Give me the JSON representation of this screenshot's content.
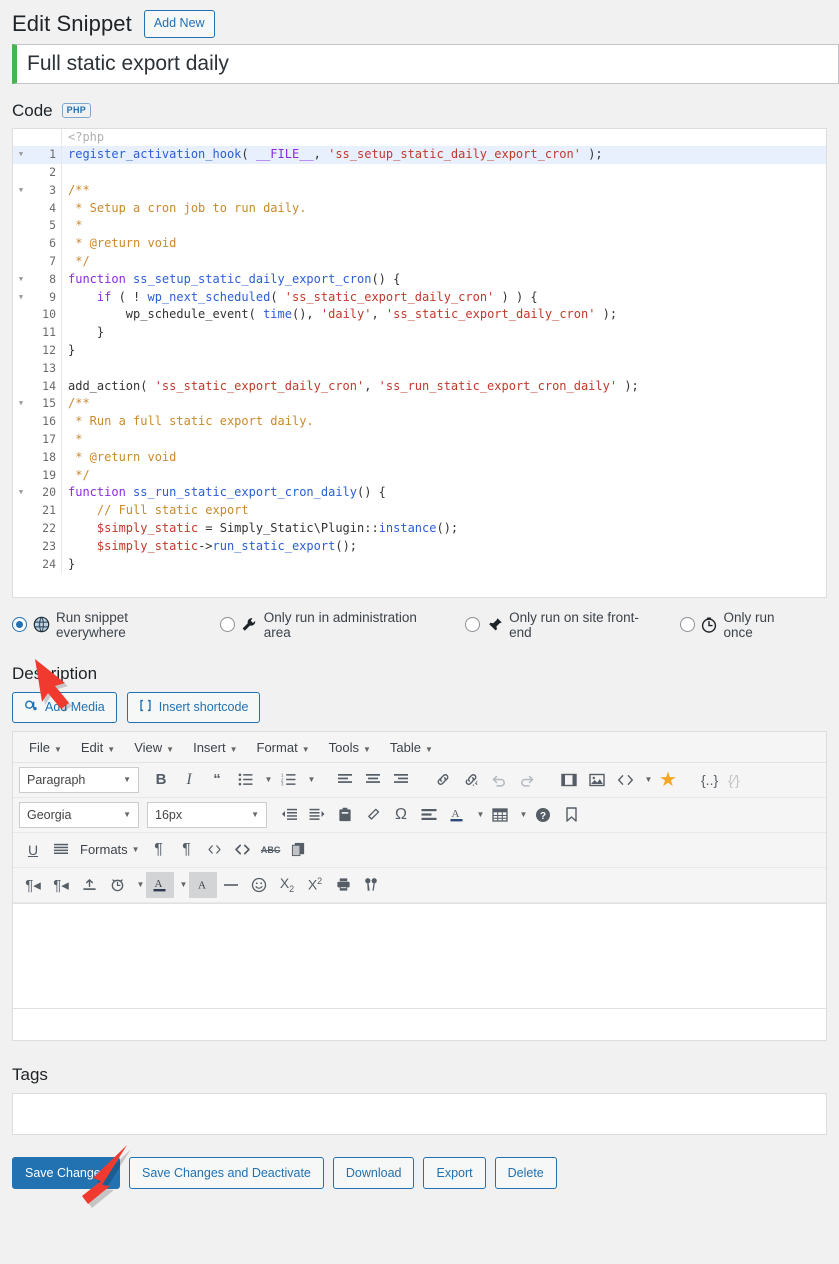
{
  "header": {
    "title": "Edit Snippet",
    "add_new_label": "Add New"
  },
  "snippet": {
    "name_value": "Full static export daily",
    "code_label": "Code",
    "language_badge": "PHP"
  },
  "editor": {
    "placeholder_line": "<?php",
    "lines": [
      {
        "n": "1",
        "fold": true,
        "active": true,
        "html": "<span class=\"fn\">register_activation_hook</span><span class=\"pl\">( </span><span class=\"k\">__FILE__</span><span class=\"pl\">, </span><span class=\"st\">'ss_setup_static_daily_export_cron'</span><span class=\"pl\"> );</span>"
      },
      {
        "n": "2",
        "fold": false,
        "active": false,
        "html": ""
      },
      {
        "n": "3",
        "fold": true,
        "active": false,
        "html": "<span class=\"cm\">/**</span>"
      },
      {
        "n": "4",
        "fold": false,
        "active": false,
        "html": "<span class=\"cm\"> * Setup a cron job to run daily.</span>"
      },
      {
        "n": "5",
        "fold": false,
        "active": false,
        "html": "<span class=\"cm\"> *</span>"
      },
      {
        "n": "6",
        "fold": false,
        "active": false,
        "html": "<span class=\"cm\"> * @return void</span>"
      },
      {
        "n": "7",
        "fold": false,
        "active": false,
        "html": "<span class=\"cm\"> */</span>"
      },
      {
        "n": "8",
        "fold": true,
        "active": false,
        "html": "<span class=\"k\">function</span> <span class=\"fn\">ss_setup_static_daily_export_cron</span><span class=\"pl\">() {</span>"
      },
      {
        "n": "9",
        "fold": true,
        "active": false,
        "html": "<span class=\"pl\">    </span><span class=\"k\">if</span><span class=\"pl\"> ( ! </span><span class=\"fn\">wp_next_scheduled</span><span class=\"pl\">( </span><span class=\"st\">'ss_static_export_daily_cron'</span><span class=\"pl\"> ) ) {</span>"
      },
      {
        "n": "10",
        "fold": false,
        "active": false,
        "html": "<span class=\"pl\">        wp_schedule_event( </span><span class=\"fn\">time</span><span class=\"pl\">(), </span><span class=\"st\">'daily'</span><span class=\"pl\">, </span><span class=\"st\">'ss_static_export_daily_cron'</span><span class=\"pl\"> );</span>"
      },
      {
        "n": "11",
        "fold": false,
        "active": false,
        "html": "<span class=\"pl\">    }</span>"
      },
      {
        "n": "12",
        "fold": false,
        "active": false,
        "html": "<span class=\"pl\">}</span>"
      },
      {
        "n": "13",
        "fold": false,
        "active": false,
        "html": ""
      },
      {
        "n": "14",
        "fold": false,
        "active": false,
        "html": "<span class=\"pl\">add_action( </span><span class=\"st\">'ss_static_export_daily_cron'</span><span class=\"pl\">, </span><span class=\"st\">'ss_run_static_export_cron_daily'</span><span class=\"pl\"> );</span>"
      },
      {
        "n": "15",
        "fold": true,
        "active": false,
        "html": "<span class=\"cm\">/**</span>"
      },
      {
        "n": "16",
        "fold": false,
        "active": false,
        "html": "<span class=\"cm\"> * Run a full static export daily.</span>"
      },
      {
        "n": "17",
        "fold": false,
        "active": false,
        "html": "<span class=\"cm\"> *</span>"
      },
      {
        "n": "18",
        "fold": false,
        "active": false,
        "html": "<span class=\"cm\"> * @return void</span>"
      },
      {
        "n": "19",
        "fold": false,
        "active": false,
        "html": "<span class=\"cm\"> */</span>"
      },
      {
        "n": "20",
        "fold": true,
        "active": false,
        "html": "<span class=\"k\">function</span> <span class=\"fn\">ss_run_static_export_cron_daily</span><span class=\"pl\">() {</span>"
      },
      {
        "n": "21",
        "fold": false,
        "active": false,
        "html": "<span class=\"pl\">    </span><span class=\"cm\">// Full static export</span>"
      },
      {
        "n": "22",
        "fold": false,
        "active": false,
        "html": "<span class=\"pl\">    </span><span class=\"vr\">$simply_static</span><span class=\"pl\"> = Simply_Static\\Plugin::</span><span class=\"fn\">instance</span><span class=\"pl\">();</span>"
      },
      {
        "n": "23",
        "fold": false,
        "active": false,
        "html": "<span class=\"pl\">    </span><span class=\"vr\">$simply_static</span><span class=\"pl\">-&gt;</span><span class=\"fn\">run_static_export</span><span class=\"pl\">();</span>"
      },
      {
        "n": "24",
        "fold": false,
        "active": false,
        "html": "<span class=\"pl\">}</span>"
      }
    ]
  },
  "scope": {
    "options": [
      {
        "label": "Run snippet everywhere",
        "icon": "globe-icon",
        "selected": true
      },
      {
        "label": "Only run in administration area",
        "icon": "wrench-icon",
        "selected": false
      },
      {
        "label": "Only run on site front-end",
        "icon": "pushpin-icon",
        "selected": false
      },
      {
        "label": "Only run once",
        "icon": "clock-icon",
        "selected": false
      }
    ]
  },
  "description": {
    "section_title": "Description",
    "add_media_label": "Add Media",
    "insert_shortcode_label": "Insert shortcode",
    "menubar": [
      "File",
      "Edit",
      "View",
      "Insert",
      "Format",
      "Tools",
      "Table"
    ],
    "paragraph_select": "Paragraph",
    "font_family_select": "Georgia",
    "font_size_select": "16px",
    "formats_label": "Formats",
    "content_value": ""
  },
  "tags": {
    "section_title": "Tags",
    "value": ""
  },
  "actions": {
    "save": "Save Changes",
    "save_deactivate": "Save Changes and Deactivate",
    "download": "Download",
    "export": "Export",
    "delete": "Delete"
  },
  "colors": {
    "primary": "#2271b1",
    "accent_green": "#46b450",
    "arrow_red": "#f03a2f",
    "active_line": "#e8f0fe"
  }
}
